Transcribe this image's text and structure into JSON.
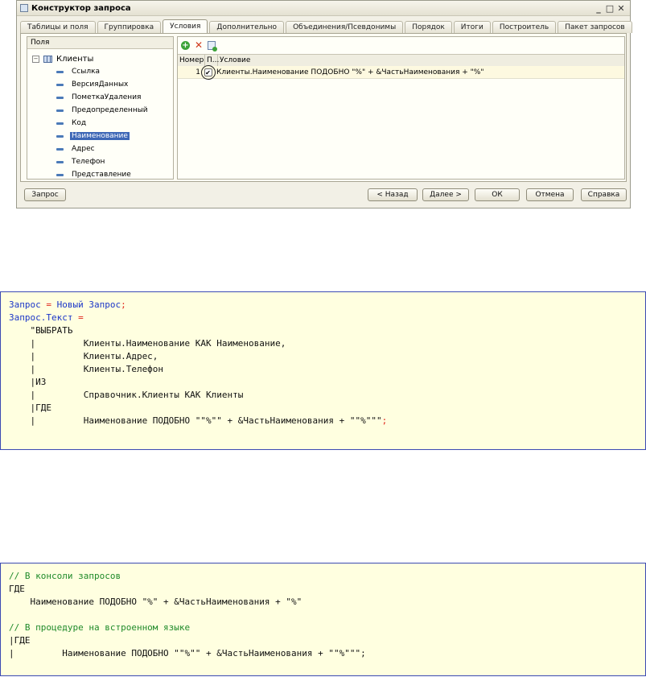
{
  "window": {
    "title": "Конструктор запроса",
    "controls": [
      "_",
      "□",
      "✕"
    ]
  },
  "tabs": [
    {
      "label": "Таблицы и поля",
      "active": false
    },
    {
      "label": "Группировка",
      "active": false
    },
    {
      "label": "Условия",
      "active": true
    },
    {
      "label": "Дополнительно",
      "active": false
    },
    {
      "label": "Объединения/Псевдонимы",
      "active": false
    },
    {
      "label": "Порядок",
      "active": false
    },
    {
      "label": "Итоги",
      "active": false
    },
    {
      "label": "Построитель",
      "active": false
    },
    {
      "label": "Пакет запросов",
      "active": false
    }
  ],
  "fields": {
    "header": "Поля",
    "root": "Клиенты",
    "items": [
      {
        "label": "Ссылка",
        "selected": false
      },
      {
        "label": "ВерсияДанных",
        "selected": false
      },
      {
        "label": "ПометкаУдаления",
        "selected": false
      },
      {
        "label": "Предопределенный",
        "selected": false
      },
      {
        "label": "Код",
        "selected": false
      },
      {
        "label": "Наименование",
        "selected": true
      },
      {
        "label": "Адрес",
        "selected": false
      },
      {
        "label": "Телефон",
        "selected": false
      },
      {
        "label": "Представление",
        "selected": false
      }
    ]
  },
  "conditions": {
    "columns": {
      "num": "Номер",
      "p": "П...",
      "cond": "Условие"
    },
    "rows": [
      {
        "num": "1",
        "checked": true,
        "condition": "Клиенты.Наименование ПОДОБНО \"%\" + &ЧастьНаименования + \"%\""
      }
    ]
  },
  "buttons": {
    "query": "Запрос",
    "back": "< Назад",
    "next": "Далее >",
    "ok": "ОК",
    "cancel": "Отмена",
    "help": "Справка"
  },
  "code1": {
    "l1_a": "Запрос",
    "l1_b": " = ",
    "l1_c": "Новый Запрос",
    "l1_d": ";",
    "l2_a": "Запрос.Текст",
    "l2_b": " =",
    "l3": "    \"ВЫБРАТЬ",
    "l4": "    |         Клиенты.Наименование КАК Наименование,",
    "l5": "    |         Клиенты.Адрес,",
    "l6": "    |         Клиенты.Телефон",
    "l7": "    |ИЗ",
    "l8": "    |         Справочник.Клиенты КАК Клиенты",
    "l9": "    |ГДЕ",
    "l10": "    |         Наименование ПОДОБНО \"\"%\"\" + &ЧастьНаименования + \"\"%\"\"\"",
    "l10_semi": ";"
  },
  "code2": {
    "l1": "// В консоли запросов",
    "l2": "ГДЕ",
    "l3": "    Наименование ПОДОБНО \"%\" + &ЧастьНаименования + \"%\"",
    "l4": "",
    "l5": "// В процедуре на встроенном языке",
    "l6": "|ГДЕ",
    "l7": "|         Наименование ПОДОБНО \"\"%\"\" + &ЧастьНаименования + \"\"%\"\"\";"
  }
}
